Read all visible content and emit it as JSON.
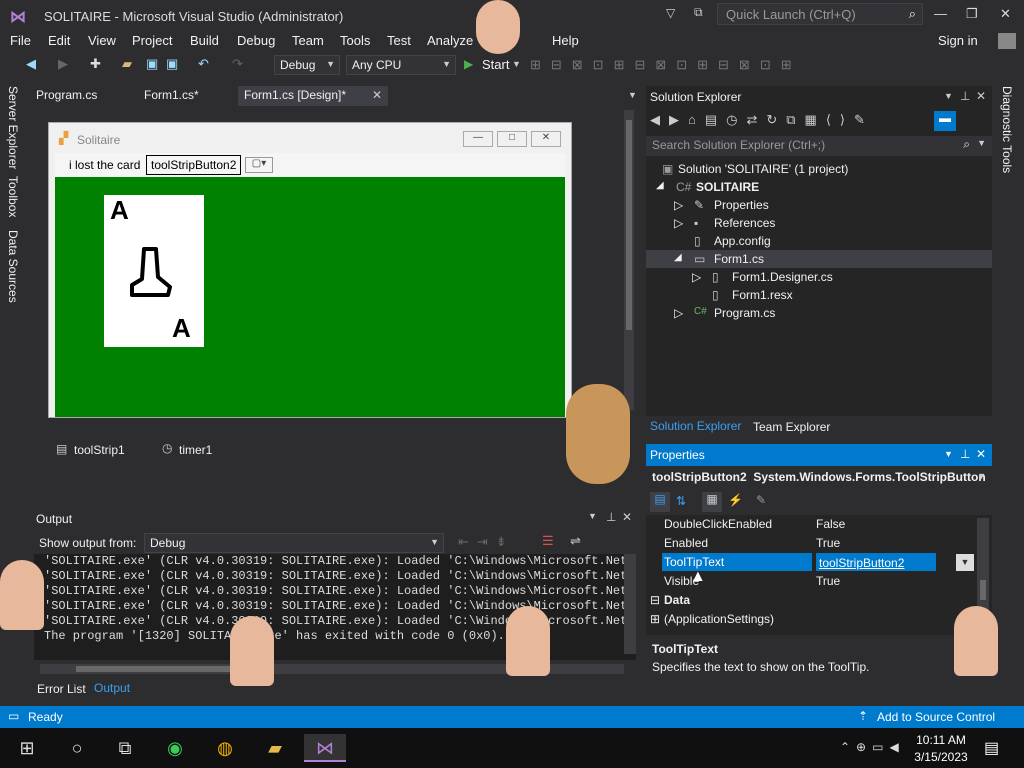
{
  "window": {
    "title": "SOLITAIRE - Microsoft Visual Studio  (Administrator)",
    "quick_launch_placeholder": "Quick Launch (Ctrl+Q)",
    "sign_in": "Sign in"
  },
  "menu": [
    "File",
    "Edit",
    "View",
    "Project",
    "Build",
    "Debug",
    "Team",
    "Tools",
    "Test",
    "Analyze",
    "Help"
  ],
  "toolbar": {
    "config": "Debug",
    "platform": "Any CPU",
    "start": "Start"
  },
  "left_tabs": [
    "Server Explorer",
    "Toolbox",
    "Data Sources"
  ],
  "right_tab": "Diagnostic Tools",
  "doc_tabs": [
    "Program.cs",
    "Form1.cs*",
    "Form1.cs [Design]*"
  ],
  "form": {
    "title": "Solitaire",
    "label": "i lost the card",
    "button": "toolStripButton2",
    "card_letter_top": "A",
    "card_letter_bottom": "A"
  },
  "tray": {
    "items": [
      "toolStrip1",
      "timer1"
    ]
  },
  "output": {
    "title": "Output",
    "show_from_label": "Show output from:",
    "source": "Debug",
    "lines": [
      "'SOLITAIRE.exe' (CLR v4.0.30319: SOLITAIRE.exe): Loaded 'C:\\Windows\\Microsoft.Net\\a",
      "'SOLITAIRE.exe' (CLR v4.0.30319: SOLITAIRE.exe): Loaded 'C:\\Windows\\Microsoft.Net\\a",
      "'SOLITAIRE.exe' (CLR v4.0.30319: SOLITAIRE.exe): Loaded 'C:\\Windows\\Microsoft.Net\\a",
      "'SOLITAIRE.exe' (CLR v4.0.30319: SOLITAIRE.exe): Loaded 'C:\\Windows\\Microsoft.Net\\a",
      "'SOLITAIRE.exe' (CLR v4.0.30319: SOLITAIRE.exe): Loaded 'C:\\Windows\\Microsoft.Net\\a",
      "The program '[1320] SOLITAIRE.exe' has exited with code 0 (0x0)."
    ]
  },
  "bottom_tabs": [
    "Error List",
    "Output"
  ],
  "solution_explorer": {
    "title": "Solution Explorer",
    "search_placeholder": "Search Solution Explorer (Ctrl+;)",
    "tree": [
      {
        "label": "Solution 'SOLITAIRE' (1 project)",
        "indent": 0
      },
      {
        "label": "SOLITAIRE",
        "indent": 1
      },
      {
        "label": "Properties",
        "indent": 2
      },
      {
        "label": "References",
        "indent": 2
      },
      {
        "label": "App.config",
        "indent": 2
      },
      {
        "label": "Form1.cs",
        "indent": 2
      },
      {
        "label": "Form1.Designer.cs",
        "indent": 3
      },
      {
        "label": "Form1.resx",
        "indent": 3
      },
      {
        "label": "Program.cs",
        "indent": 2
      }
    ],
    "tabs": [
      "Solution Explorer",
      "Team Explorer"
    ]
  },
  "properties": {
    "title": "Properties",
    "object": "toolStripButton2  System.Windows.Forms.ToolStripButton",
    "rows": [
      {
        "k": "DoubleClickEnabled",
        "v": "False"
      },
      {
        "k": "Enabled",
        "v": "True"
      },
      {
        "k": "ToolTipText",
        "v": "toolStripButton2"
      },
      {
        "k": "Visible",
        "v": "True"
      }
    ],
    "section": "Data",
    "section_item": "(ApplicationSettings)",
    "desc_title": "ToolTipText",
    "desc_text": "Specifies the text to show on the ToolTip."
  },
  "status": {
    "text": "Ready",
    "source_control": "Add to Source Control"
  },
  "clock": {
    "time": "10:11 AM",
    "date": "3/15/2023"
  }
}
